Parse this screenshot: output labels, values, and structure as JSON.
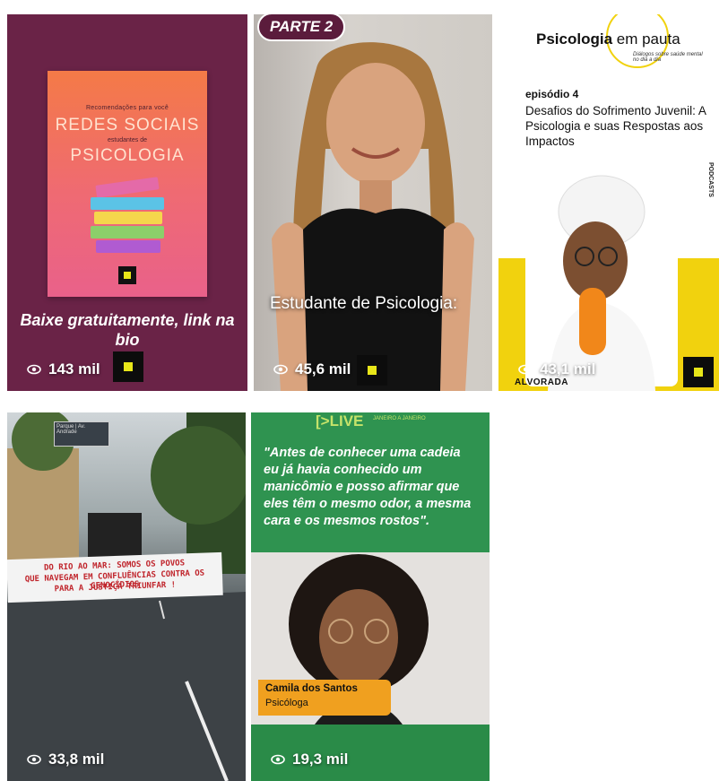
{
  "posts": [
    {
      "book": {
        "tagline": "Recomendações para você",
        "title_line1": "REDES SOCIAIS",
        "subtitle": "estudantes de",
        "title_line2": "PSICOLOGIA"
      },
      "caption": "Baixe gratuitamente, link na bio",
      "views": "143 mil"
    },
    {
      "tag": "PARTE 2",
      "caption": "Estudante de Psicologia:",
      "views": "45,6 mil"
    },
    {
      "brand": "Psicologia",
      "brand_suffix": "em pauta",
      "brand_sub": "Diálogos sobre saúde mental no dia a dia",
      "episode": "episódio 4",
      "title": "Desafios do Sofrimento Juvenil: A Psicologia e suas Respostas aos Impactos",
      "side_label": "PODCASTS",
      "footer": "ALVORADA",
      "views": "43,1 mil"
    },
    {
      "sign": "Parque | Av. Andrade",
      "banner_line1": "DO RIO AO MAR: SOMOS OS POVOS",
      "banner_line2": "QUE NAVEGAM EM CONFLUÊNCIAS CONTRA OS GENOCÍDIOS",
      "banner_line3": "PARA A JUSTIÇA TRIUNFAR !",
      "views": "33,8 mil"
    },
    {
      "live": "[>LIVE",
      "live_sub": "JANEIRO A JANEIRO",
      "quote": "\"Antes de conhecer uma cadeia eu já havia conhecido um manicômio e posso afirmar que eles têm o mesmo odor, a mesma cara e os mesmos rostos\".",
      "name": "Camila dos Santos",
      "role": "Psicóloga",
      "views": "19,3 mil"
    }
  ],
  "colors": {
    "tile1_bg": "#6a2347",
    "tile3_accent": "#f1d20e",
    "tile5_bg": "#2f9350",
    "badge_yellow": "#e8e619",
    "name_tag": "#f0a01f"
  },
  "icons": {
    "views": "eye-icon",
    "badge": "square-logo-icon"
  }
}
